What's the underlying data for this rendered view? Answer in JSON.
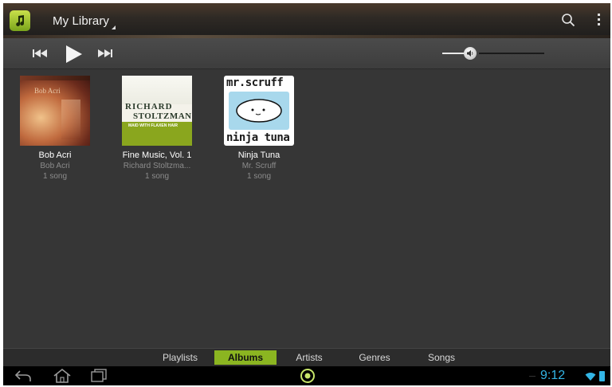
{
  "app": {
    "title": "My Library",
    "icon": "music-note-icon",
    "accent": "#8bb521"
  },
  "actionbar": {
    "search_icon": "search-icon",
    "overflow_icon": "overflow-menu-icon"
  },
  "transport": {
    "prev_icon": "skip-previous-icon",
    "play_icon": "play-icon",
    "next_icon": "skip-next-icon",
    "volume_icon": "volume-icon",
    "volume_level": 0.28
  },
  "albums": [
    {
      "title": "Bob Acri",
      "artist": "Bob Acri",
      "count": "1 song",
      "cover_text": "Bob Acri"
    },
    {
      "title": "Fine Music, Vol. 1",
      "artist": "Richard Stoltzma...",
      "count": "1 song",
      "cover_line1": "RICHARD",
      "cover_line2": "STOLTZMAN",
      "cover_sub": "MAID WITH FLAXEN HAIR"
    },
    {
      "title": "Ninja Tuna",
      "artist": "Mr. Scruff",
      "count": "1 song",
      "cover_top": "mr.scruff",
      "cover_bottom": "ninja tuna"
    }
  ],
  "tabs": [
    {
      "label": "Playlists",
      "active": false
    },
    {
      "label": "Albums",
      "active": true
    },
    {
      "label": "Artists",
      "active": false
    },
    {
      "label": "Genres",
      "active": false
    },
    {
      "label": "Songs",
      "active": false
    }
  ],
  "navbar": {
    "time": "9:12",
    "time_color": "#33b5e5"
  }
}
